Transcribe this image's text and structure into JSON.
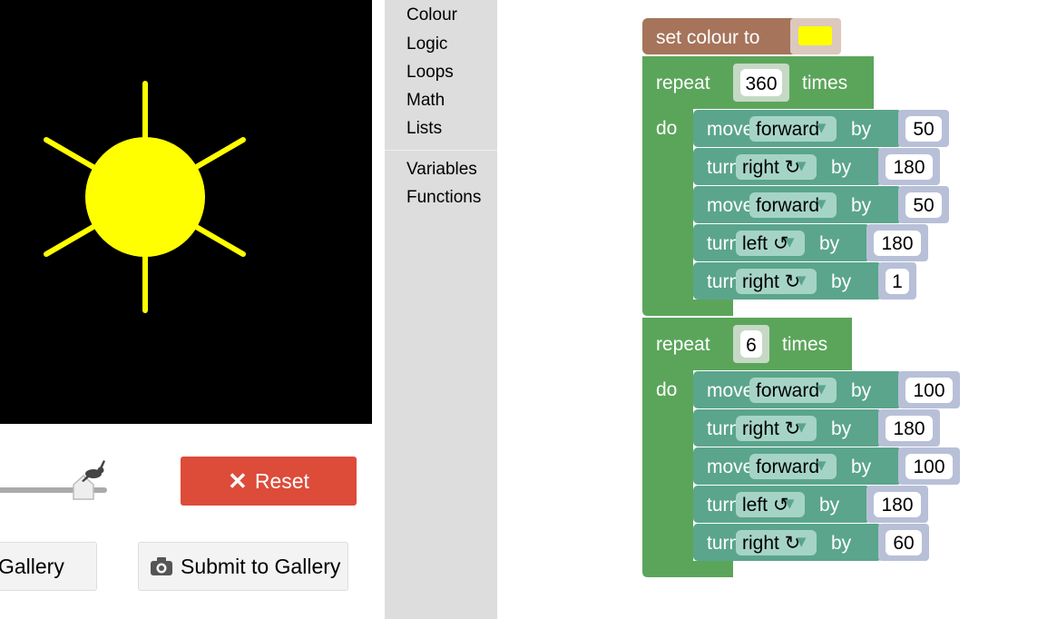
{
  "controls": {
    "reset_label": "Reset",
    "see_gallery_label": "ee Gallery",
    "submit_gallery_label": "Submit to Gallery"
  },
  "toolbox": {
    "items": [
      "Colour",
      "Logic",
      "Loops",
      "Math",
      "Lists",
      "Variables",
      "Functions"
    ]
  },
  "colors": {
    "canvas_bg": "#000000",
    "drawing": "#ffff00",
    "colour_block": "#a5745b",
    "loop_block": "#5ba55b",
    "turtle_block": "#5ba58c",
    "reset": "#dd4b39"
  },
  "program": {
    "set_colour": {
      "label": "set colour to",
      "value": "#ffff00"
    },
    "loops": [
      {
        "repeat_label": "repeat",
        "count": "360",
        "times_label": "times",
        "do_label": "do",
        "statements": [
          {
            "cmd": "move",
            "dir": "forward",
            "by": "by",
            "value": "50"
          },
          {
            "cmd": "turn",
            "dir": "right ↻",
            "by": "by",
            "value": "180"
          },
          {
            "cmd": "move",
            "dir": "forward",
            "by": "by",
            "value": "50"
          },
          {
            "cmd": "turn",
            "dir": "left ↺",
            "by": "by",
            "value": "180"
          },
          {
            "cmd": "turn",
            "dir": "right ↻",
            "by": "by",
            "value": "1"
          }
        ]
      },
      {
        "repeat_label": "repeat",
        "count": "6",
        "times_label": "times",
        "do_label": "do",
        "statements": [
          {
            "cmd": "move",
            "dir": "forward",
            "by": "by",
            "value": "100"
          },
          {
            "cmd": "turn",
            "dir": "right ↻",
            "by": "by",
            "value": "180"
          },
          {
            "cmd": "move",
            "dir": "forward",
            "by": "by",
            "value": "100"
          },
          {
            "cmd": "turn",
            "dir": "left ↺",
            "by": "by",
            "value": "180"
          },
          {
            "cmd": "turn",
            "dir": "right ↻",
            "by": "by",
            "value": "60"
          }
        ]
      }
    ]
  }
}
